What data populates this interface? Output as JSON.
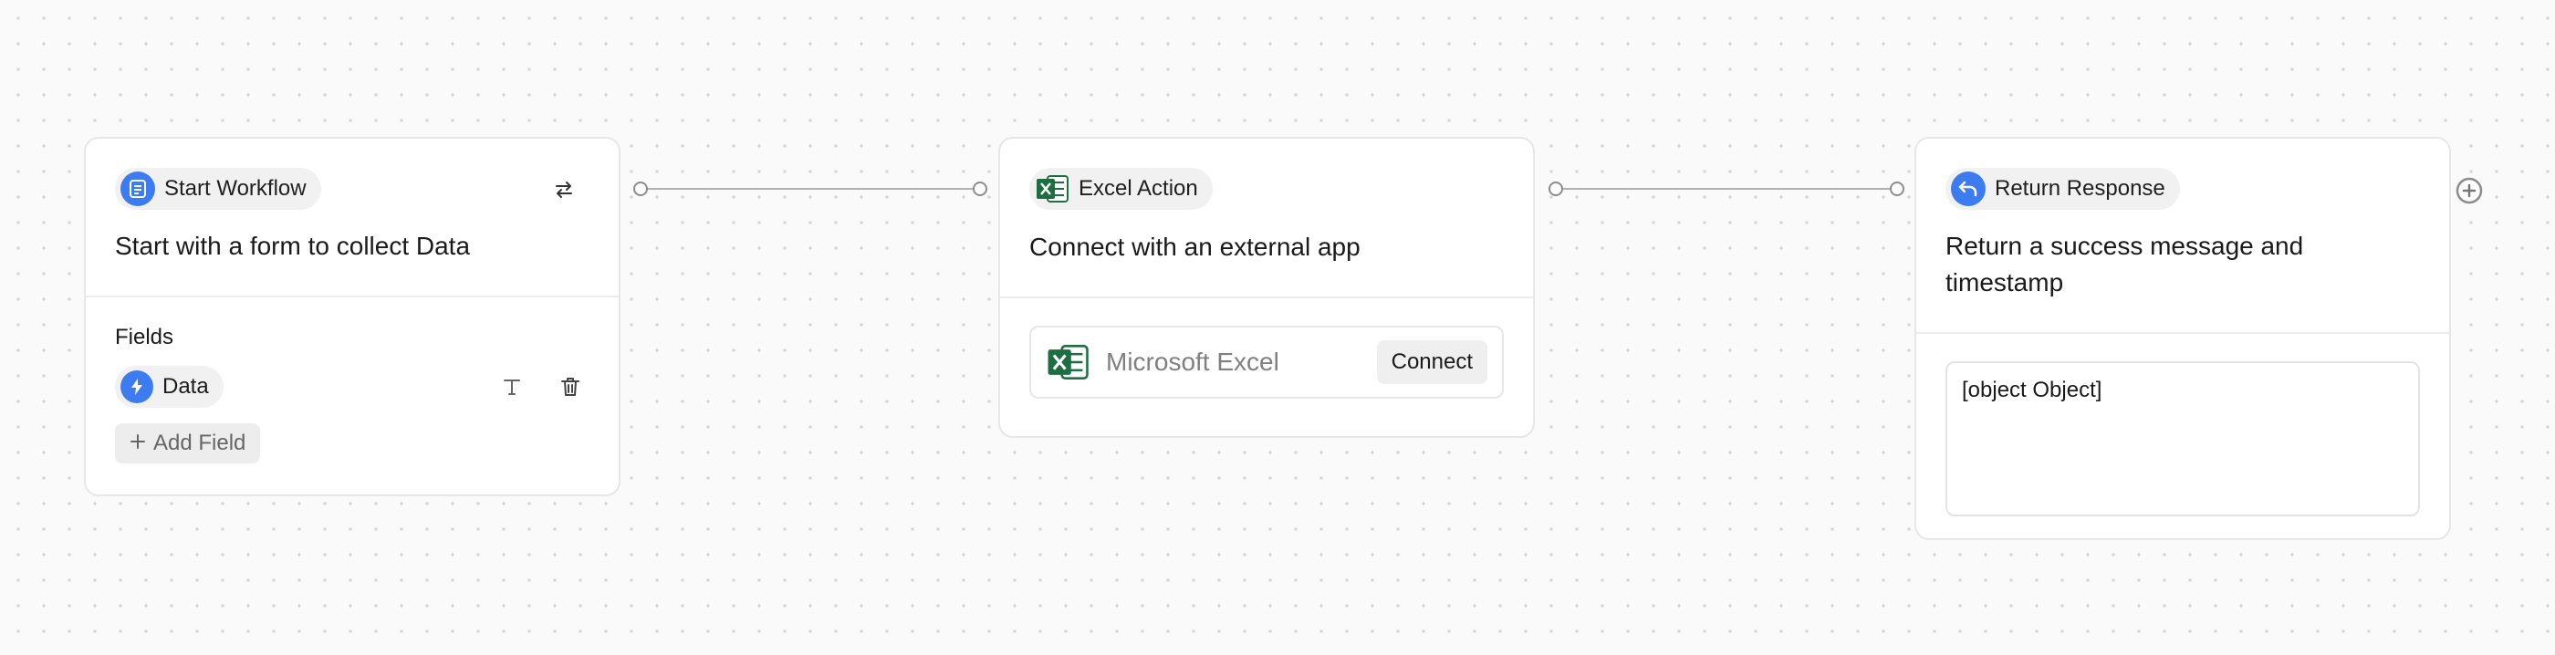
{
  "nodes": {
    "start": {
      "badge": "Start Workflow",
      "title": "Start with a form to collect Data",
      "fields_label": "Fields",
      "fields": [
        {
          "name": "Data",
          "type_icon": "text-type-icon"
        }
      ],
      "add_field_label": "Add Field"
    },
    "excel": {
      "badge": "Excel Action",
      "title": "Connect with an external app",
      "app_name": "Microsoft Excel",
      "connect_label": "Connect"
    },
    "response": {
      "badge": "Return Response",
      "title": "Return a success message and timestamp",
      "response_value": "[object Object]"
    }
  },
  "colors": {
    "accent_blue": "#3d7bf0",
    "excel_green": "#1d6f42",
    "canvas_bg": "#fafafa"
  },
  "icons": [
    "form-icon",
    "swap-icon",
    "bolt-icon",
    "text-type-icon",
    "trash-icon",
    "plus-icon",
    "excel-icon",
    "return-arrow-icon",
    "add-node-icon"
  ]
}
